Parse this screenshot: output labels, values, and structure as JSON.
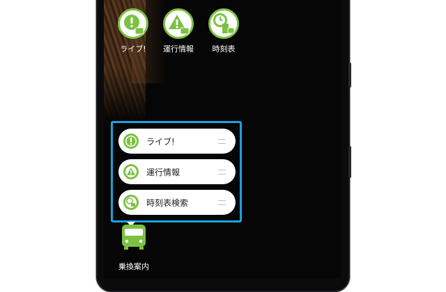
{
  "home": {
    "apps": [
      {
        "label": "ライブ!",
        "icon": "exclamation-train-icon"
      },
      {
        "label": "運行情報",
        "icon": "warning-train-icon"
      },
      {
        "label": "時刻表",
        "icon": "clock-building-train-icon"
      }
    ],
    "dock_app": {
      "label": "乗換案内",
      "icon": "train-icon"
    }
  },
  "shortcuts": {
    "items": [
      {
        "label": "ライブ!",
        "icon": "exclamation-icon"
      },
      {
        "label": "運行情報",
        "icon": "warning-icon"
      },
      {
        "label": "時刻表検索",
        "icon": "timetable-icon"
      }
    ],
    "highlight_color": "#1aa3e0"
  },
  "colors": {
    "accent": "#7cc142",
    "screen": "#060606",
    "pill": "#ffffff"
  }
}
